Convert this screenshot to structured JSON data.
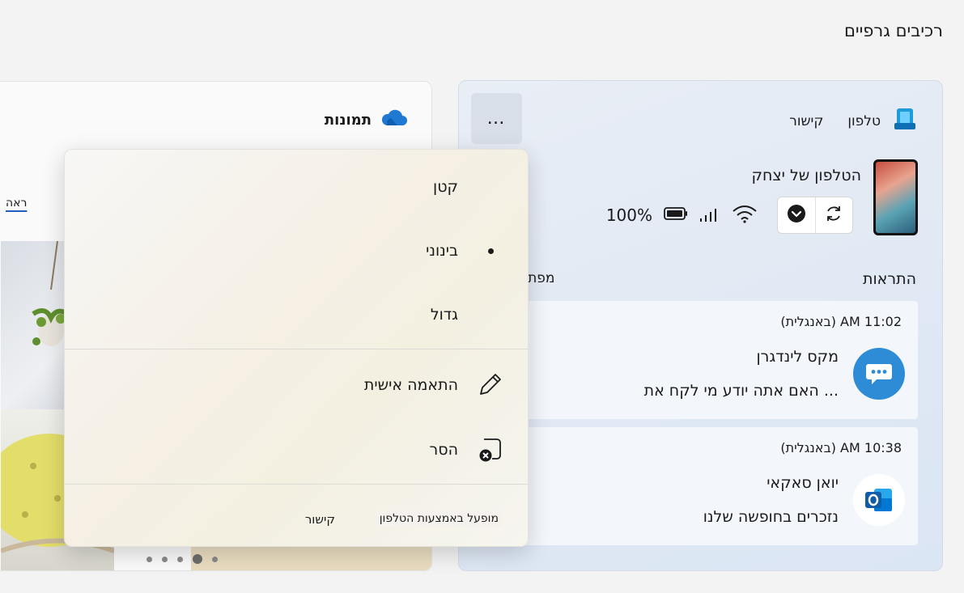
{
  "page": {
    "title": "רכיבים גרפיים"
  },
  "photos_widget": {
    "title": "תמונות",
    "icon": "onedrive-cloud-icon",
    "see_link": "ראה",
    "dots_count": 5,
    "active_dot": 2
  },
  "phone_widget": {
    "header": {
      "title": "טלפון",
      "link": "קישור",
      "more": "…"
    },
    "phone_name": "הטלפון של יצחק",
    "battery": "100%",
    "alerts_label": "התראות",
    "open_label": "מפתח",
    "notifications": [
      {
        "time": "11:02 AM (באנגלית)",
        "sender": "מקס לינדגרן",
        "text": "האם אתה יודע מי לקח את ...",
        "app_icon": "messages-icon",
        "app_color": "#2e8bd6"
      },
      {
        "time": "10:38 AM (באנגלית)",
        "sender": "יואן סאקאי",
        "text": "נזכרים בחופשה שלנו",
        "app_icon": "outlook-icon",
        "app_color": "#0f6cbd"
      }
    ]
  },
  "context_menu": {
    "items": [
      {
        "label": "קטן",
        "selected": false
      },
      {
        "label": "בינוני",
        "selected": true
      },
      {
        "label": "גדול",
        "selected": false
      }
    ],
    "customize": "התאמה אישית",
    "remove": "הסר",
    "footer_text": "מופעל באמצעות הטלפון",
    "footer_link": "קישור"
  }
}
